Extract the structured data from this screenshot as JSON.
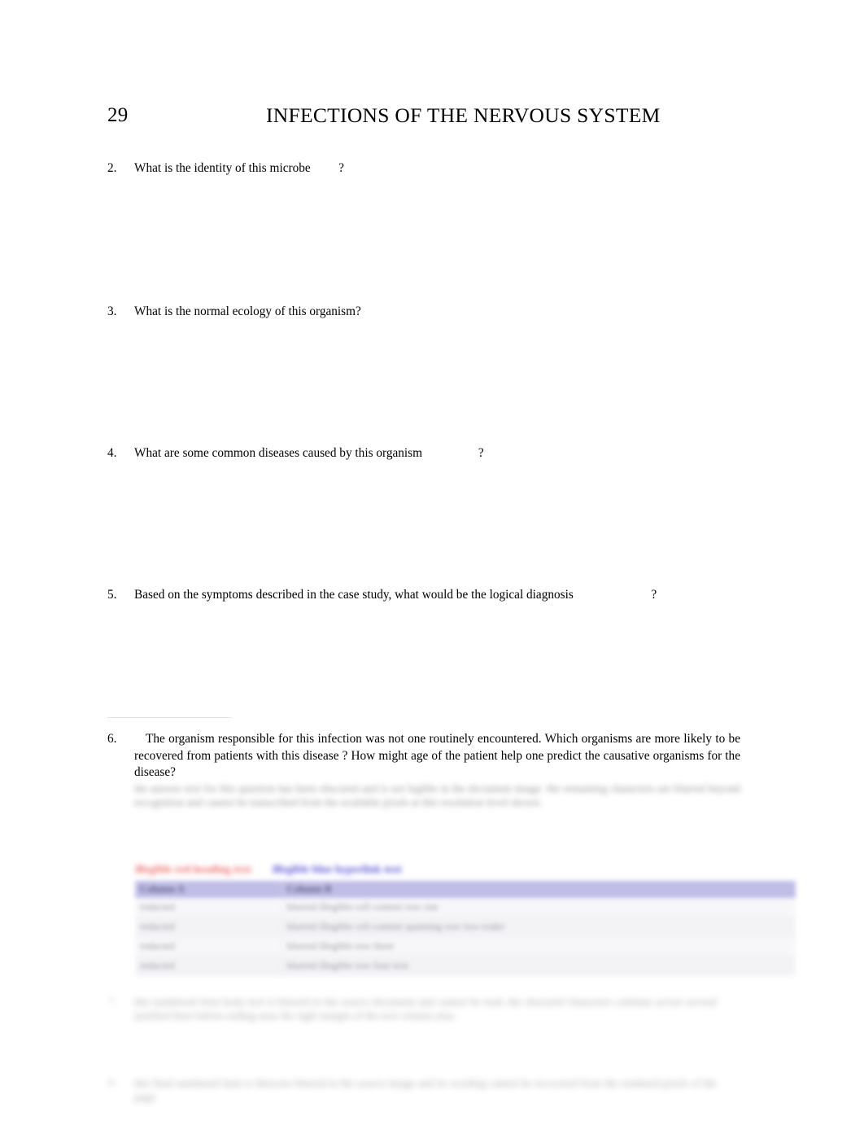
{
  "header": {
    "page_number": "29",
    "title": "INFECTIONS OF THE NERVOUS SYSTEM"
  },
  "questions": [
    {
      "number": "2.",
      "text": "What is the identity of this microbe         ?"
    },
    {
      "number": "3.",
      "text": "What is the normal ecology of this organism?"
    },
    {
      "number": "4.",
      "text": "What are some common diseases caused by this organism                  ?"
    },
    {
      "number": "5.",
      "text": "Based on the symptoms described in the case study, what would be the logical diagnosis                         ?"
    }
  ],
  "question6": {
    "number": "6.",
    "text": "The organism responsible for this infection was not one routinely encountered.          Which organisms are more likely to be recovered from patients with this disease                   ?  How might age of the patient help one predict the causative organisms for the disease?"
  },
  "redacted": {
    "answer6": "the answer text for this question has been obscured and is not legible in the document image. the remaining characters are blurred beyond recognition and cannot be transcribed from the available pixels at this resolution level shown.",
    "caption_red": "illegible red heading text",
    "caption_blue": "illegible blue hyperlink text",
    "item7_number": "7.",
    "item7": "this numbered item body text is blurred in the source document and cannot be read. the obscured characters continue across several justified lines before ending near the right margin of the text column area.",
    "item8_number": "8.",
    "item8": "this final numbered item is likewise blurred in the source image and its wording cannot be recovered from the rendered pixels of the page."
  },
  "table": {
    "headers": [
      "Column A",
      "Column B"
    ],
    "rows": [
      [
        "redacted",
        "blurred illegible cell content row one"
      ],
      [
        "redacted",
        "blurred illegible cell content spanning row two wider"
      ],
      [
        "redacted",
        "blurred illegible row three"
      ],
      [
        "redacted",
        "blurred illegible row four text"
      ]
    ]
  },
  "colors": {
    "table_header": "#b9b6e4",
    "caption_red": "#e8544a",
    "caption_blue": "#3b37cf"
  }
}
